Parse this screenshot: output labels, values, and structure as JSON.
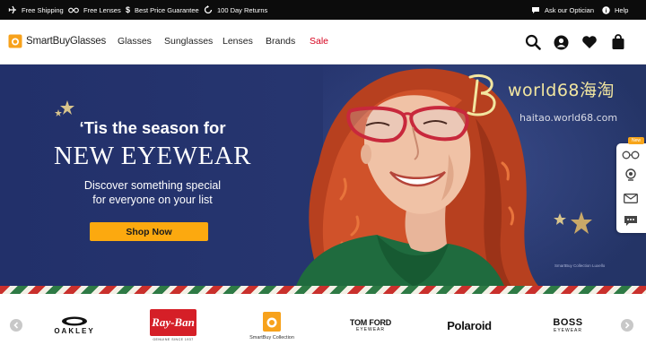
{
  "topbar": {
    "perks": [
      {
        "icon": "plane-icon",
        "label": "Free Shipping"
      },
      {
        "icon": "glasses-icon",
        "label": "Free Lenses"
      },
      {
        "icon": "dollar-icon",
        "label": "Best Price Guarantee"
      },
      {
        "icon": "return-icon",
        "label": "100 Day Returns"
      }
    ],
    "ask_optician": "Ask our Optician",
    "help": "Help"
  },
  "header": {
    "logo_text": "SmartBuyGlasses",
    "nav": [
      "Glasses",
      "Sunglasses",
      "Lenses",
      "Brands",
      "Sale"
    ],
    "icons": [
      "search-icon",
      "account-icon",
      "heart-icon",
      "bag-icon"
    ]
  },
  "hero": {
    "title_line1": "‘Tis the season for",
    "title_line2": "NEW EYEWEAR",
    "subtitle_line1": "Discover something special",
    "subtitle_line2": "for everyone on your list",
    "cta": "Shop Now",
    "credit": "SmartBuy Collection Luxello",
    "colors": {
      "background": "#26356f",
      "cta": "#fca90f",
      "frames": "#c8283c"
    }
  },
  "watermark": {
    "brand": "world68海淘",
    "url": "haitao.world68.com"
  },
  "side_widget": {
    "badge": "New",
    "icons": [
      "glasses-try-on-icon",
      "webcam-icon",
      "email-icon",
      "chat-icon"
    ]
  },
  "brands": {
    "items": [
      {
        "name": "OAKLEY"
      },
      {
        "name": "Ray-Ban",
        "tagline": "GENUINE SINCE 1937"
      },
      {
        "name": "SmartBuy Collection"
      },
      {
        "name": "TOM FORD",
        "sub": "EYEWEAR"
      },
      {
        "name": "Polaroid"
      },
      {
        "name": "BOSS",
        "sub": "EYEWEAR"
      }
    ]
  }
}
